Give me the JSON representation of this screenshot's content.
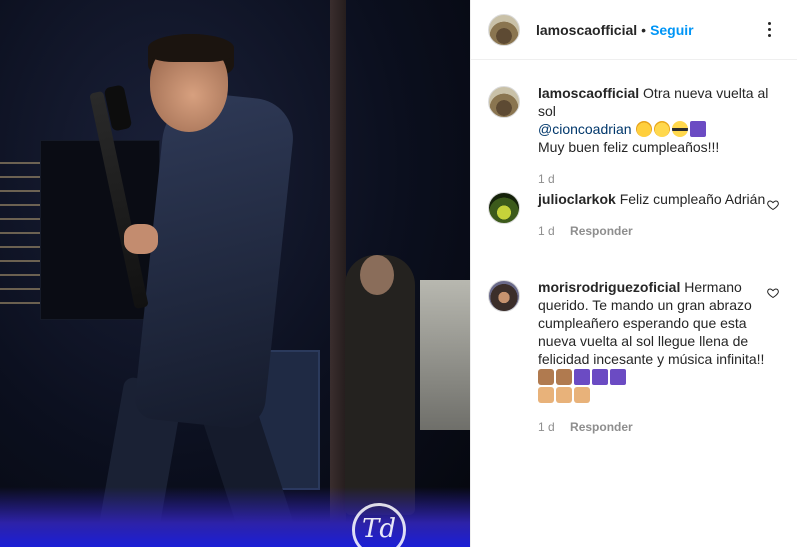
{
  "post": {
    "author": "lamoscaofficial",
    "separator": "•",
    "follow_label": "Seguir",
    "watermark": "Td"
  },
  "comments": [
    {
      "username": "lamoscaofficial",
      "text_before_mention": "Otra nueva vuelta al sol",
      "mention": "@cioncoadrian",
      "emojis": [
        "smiling-face-hearts",
        "partying-face",
        "sunglasses-face",
        "musical-notes"
      ],
      "text_after": "Muy buen feliz cumpleaños!!!",
      "time": "1 d"
    },
    {
      "username": "julioclarkok",
      "text": "Feliz cumpleaño Adrián",
      "time": "1 d",
      "reply_label": "Responder"
    },
    {
      "username": "morisrodriguezoficial",
      "text": "Hermano querido. Te mando un gran abrazo cumpleañero esperando que esta nueva vuelta al sol llegue llena de felicidad incesante y música infinita!!",
      "emojis_line1": [
        "ok-hand",
        "raised-hand",
        "musical-notes",
        "musical-note",
        "musical-notes"
      ],
      "emojis_line2": [
        "folded-hands",
        "folded-hands",
        "folded-hands"
      ],
      "time": "1 d",
      "reply_label": "Responder"
    }
  ]
}
